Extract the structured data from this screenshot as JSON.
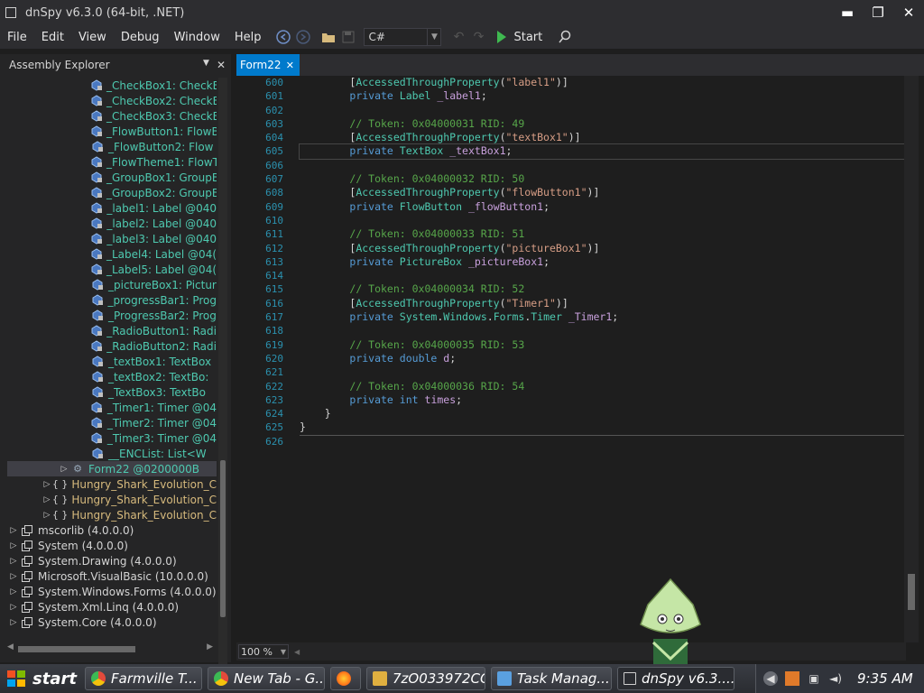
{
  "window": {
    "title": "dnSpy v6.3.0 (64-bit, .NET)",
    "minimize": "▬",
    "restore": "❐",
    "close": "✕"
  },
  "menu": [
    "File",
    "Edit",
    "View",
    "Debug",
    "Window",
    "Help"
  ],
  "toolbar": {
    "language": "C#",
    "start_label": "Start"
  },
  "explorer": {
    "title": "Assembly Explorer",
    "fields": [
      {
        "name": "_CheckBox1",
        "type": " : CheckB"
      },
      {
        "name": "_CheckBox2",
        "type": " : CheckB"
      },
      {
        "name": "_CheckBox3",
        "type": " : CheckB"
      },
      {
        "name": "_FlowButton1",
        "type": " : FlowB"
      },
      {
        "name": "_FlowButton2",
        "type": " : Flow"
      },
      {
        "name": "_FlowTheme1",
        "type": " : FlowT"
      },
      {
        "name": "_GroupBox1",
        "type": " : GroupB"
      },
      {
        "name": "_GroupBox2",
        "type": " : GroupB"
      },
      {
        "name": "_label1",
        "type": " : Label @040"
      },
      {
        "name": "_label2",
        "type": " : Label @040"
      },
      {
        "name": "_label3",
        "type": " : Label @040"
      },
      {
        "name": "_Label4",
        "type": " : Label @04("
      },
      {
        "name": "_Label5",
        "type": " : Label @04("
      },
      {
        "name": "_pictureBox1",
        "type": " : Pictur"
      },
      {
        "name": "_progressBar1",
        "type": " : Prog"
      },
      {
        "name": "_ProgressBar2",
        "type": " : Prog"
      },
      {
        "name": "_RadioButton1",
        "type": " : Radi"
      },
      {
        "name": "_RadioButton2",
        "type": " : Radi"
      },
      {
        "name": "_textBox1",
        "type": " : TextBox"
      },
      {
        "name": "_textBox2",
        "type": " : TextBo:"
      },
      {
        "name": "_TextBox3",
        "type": " : TextBo"
      },
      {
        "name": "_Timer1",
        "type": " : Timer @04"
      },
      {
        "name": "_Timer2",
        "type": " : Timer @04"
      },
      {
        "name": "_Timer3",
        "type": " : Timer @04"
      },
      {
        "name": "__ENCList",
        "type": " : List<W"
      }
    ],
    "selected_class": "Form22 @0200000B",
    "namespaces": [
      "Hungry_Shark_Evolution_C",
      "Hungry_Shark_Evolution_C",
      "Hungry_Shark_Evolution_C"
    ],
    "namespace_glyph": "{ }",
    "assemblies": [
      "mscorlib (4.0.0.0)",
      "System (4.0.0.0)",
      "System.Drawing (4.0.0.0)",
      "Microsoft.VisualBasic (10.0.0.0)",
      "System.Windows.Forms (4.0.0.0)",
      "System.Xml.Linq (4.0.0.0)",
      "System.Core (4.0.0.0)"
    ]
  },
  "editor": {
    "tab_label": "Form22",
    "zoom": "100 %",
    "current_line": 605,
    "line_numbers": [
      "600",
      "601",
      "602",
      "603",
      "604",
      "605",
      "606",
      "607",
      "608",
      "609",
      "610",
      "611",
      "612",
      "613",
      "614",
      "615",
      "616",
      "617",
      "618",
      "619",
      "620",
      "621",
      "622",
      "623",
      "624",
      "625",
      "626"
    ],
    "code": {
      "l600": {
        "attr": "AccessedThroughProperty",
        "arg": "\"label1\""
      },
      "l601": {
        "kw": "private",
        "type": "Label",
        "field": "_label1"
      },
      "l603": "// Token: 0x04000031 RID: 49",
      "l604": {
        "attr": "AccessedThroughProperty",
        "arg": "\"textBox1\""
      },
      "l605": {
        "kw": "private",
        "type": "TextBox",
        "field": "_textBox1"
      },
      "l607": "// Token: 0x04000032 RID: 50",
      "l608": {
        "attr": "AccessedThroughProperty",
        "arg": "\"flowButton1\""
      },
      "l609": {
        "kw": "private",
        "type": "FlowButton",
        "field": "_flowButton1"
      },
      "l611": "// Token: 0x04000033 RID: 51",
      "l612": {
        "attr": "AccessedThroughProperty",
        "arg": "\"pictureBox1\""
      },
      "l613": {
        "kw": "private",
        "type": "PictureBox",
        "field": "_pictureBox1"
      },
      "l615": "// Token: 0x04000034 RID: 52",
      "l616": {
        "attr": "AccessedThroughProperty",
        "arg": "\"Timer1\""
      },
      "l617": {
        "kw": "private",
        "ns1": "System",
        "ns2": "Windows",
        "ns3": "Forms",
        "type": "Timer",
        "field": "_Timer1"
      },
      "l619": "// Token: 0x04000035 RID: 53",
      "l620": {
        "kw": "private",
        "type": "double",
        "field": "d"
      },
      "l622": "// Token: 0x04000036 RID: 54",
      "l623": {
        "kw": "private",
        "type": "int",
        "field": "times"
      }
    }
  },
  "taskbar": {
    "start": "start",
    "buttons": [
      {
        "label": "Farmville T...",
        "icon_color": "#e34a3b"
      },
      {
        "label": "New Tab - G...",
        "icon_color": "#e34a3b"
      },
      {
        "label": "",
        "icon_color": "#ff7a1a"
      },
      {
        "label": "7zO033972CC",
        "icon_color": "#e0b040"
      },
      {
        "label": "Task Manag...",
        "icon_color": "#5aa0e0"
      },
      {
        "label": "dnSpy v6.3....",
        "icon_color": "#cfcfcf"
      }
    ],
    "clock": "9:35 AM"
  },
  "colors": {
    "accent": "#007acc",
    "start_green": "#3fb950",
    "comment": "#57a64a",
    "keyword": "#569cd6",
    "type": "#4ec9b0",
    "string": "#d69d85"
  }
}
